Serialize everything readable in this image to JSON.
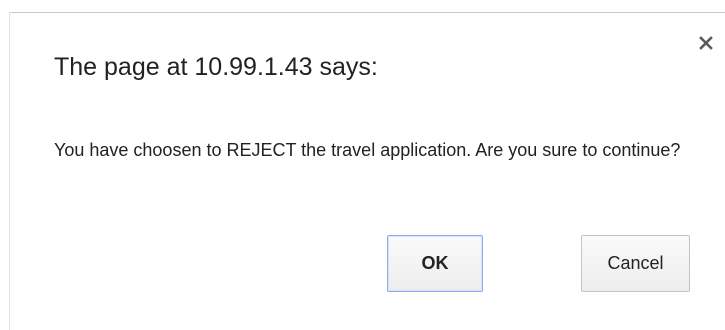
{
  "dialog": {
    "title": "The page at 10.99.1.43 says:",
    "message": "You have choosen to REJECT the travel application. Are you sure to continue?",
    "close_icon": "close-icon",
    "buttons": {
      "ok_label": "OK",
      "cancel_label": "Cancel"
    }
  }
}
